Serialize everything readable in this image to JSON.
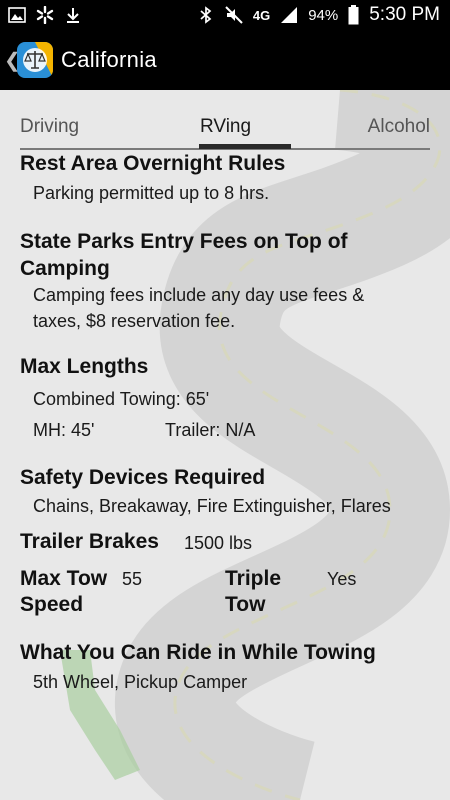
{
  "status": {
    "network": "4G",
    "battery": "94%",
    "time": "5:30 PM"
  },
  "appbar": {
    "title": "California"
  },
  "tabs": [
    "Driving",
    "RVing",
    "Alcohol"
  ],
  "sections": {
    "rest_area": {
      "title": "Rest Area Overnight Rules",
      "value": "Parking permitted up to 8 hrs."
    },
    "state_parks": {
      "title": "State Parks Entry Fees on Top of Camping",
      "value": "Camping fees include any day use fees & taxes, $8 reservation fee."
    },
    "max_lengths": {
      "title": "Max Lengths",
      "combined_towing": "Combined Towing: 65'",
      "mh": "MH: 45'",
      "trailer": "Trailer: N/A"
    },
    "safety_devices": {
      "title": "Safety Devices Required",
      "value": "Chains, Breakaway, Fire Extinguisher, Flares"
    },
    "trailer_brakes": {
      "label": "Trailer Brakes",
      "value": "1500 lbs"
    },
    "max_tow_speed": {
      "label": "Max Tow Speed",
      "value": "55"
    },
    "triple_tow": {
      "label": "Triple Tow",
      "value": "Yes"
    },
    "ride_while_towing": {
      "title": "What You Can Ride in While Towing",
      "value": "5th Wheel, Pickup Camper"
    }
  },
  "icons": {
    "back": "chevron-left-icon",
    "logo": "scales-of-justice-icon"
  }
}
